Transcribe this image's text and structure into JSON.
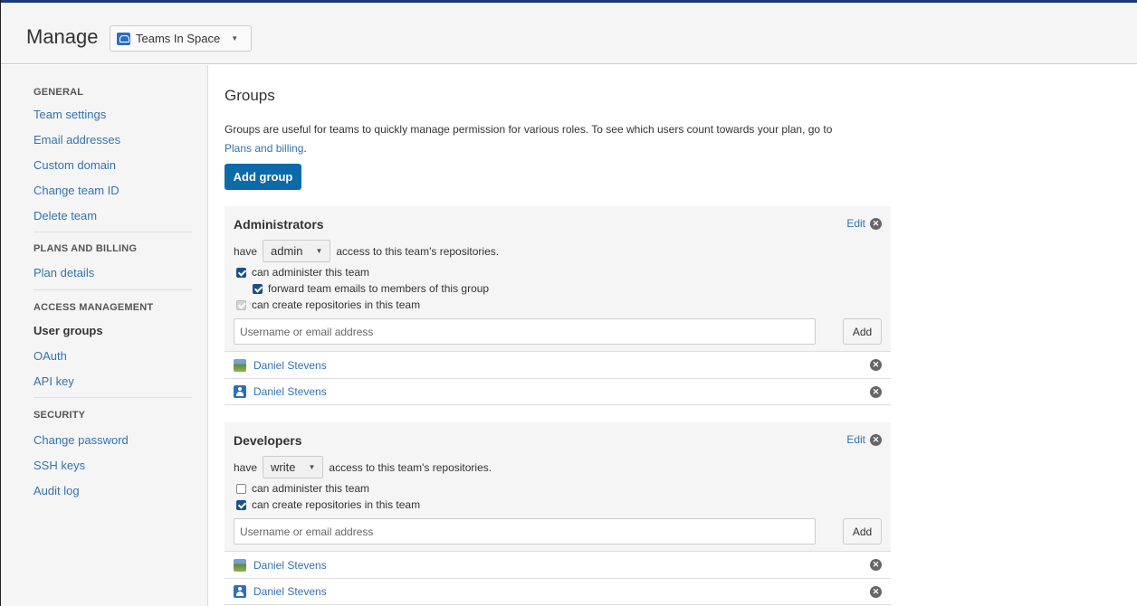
{
  "header": {
    "title": "Manage",
    "team_name": "Teams In Space"
  },
  "sidebar": {
    "general": {
      "heading": "GENERAL",
      "items": [
        "Team settings",
        "Email addresses",
        "Custom domain",
        "Change team ID",
        "Delete team"
      ]
    },
    "plans": {
      "heading": "PLANS AND BILLING",
      "items": [
        "Plan details"
      ]
    },
    "access": {
      "heading": "ACCESS MANAGEMENT",
      "items": [
        "User groups",
        "OAuth",
        "API key"
      ],
      "active": "User groups"
    },
    "security": {
      "heading": "SECURITY",
      "items": [
        "Change password",
        "SSH keys",
        "Audit log"
      ]
    }
  },
  "main": {
    "title": "Groups",
    "description": "Groups are useful for teams to quickly manage permission for various roles. To see which users count towards your plan, go to",
    "description_link": "Plans and billing",
    "description_end": ".",
    "add_group_label": "Add group"
  },
  "groups": [
    {
      "name": "Administrators",
      "edit_label": "Edit",
      "have_label": "have",
      "permission": "admin",
      "access_text": "access to this team's repositories.",
      "options": {
        "administer": "can administer this team",
        "forward": "forward team emails to members of this group",
        "create": "can create repositories in this team"
      },
      "input_placeholder": "Username or email address",
      "add_label": "Add",
      "members": [
        "Daniel Stevens",
        "Daniel Stevens"
      ]
    },
    {
      "name": "Developers",
      "edit_label": "Edit",
      "have_label": "have",
      "permission": "write",
      "access_text": "access to this team's repositories.",
      "options": {
        "administer": "can administer this team",
        "create": "can create repositories in this team"
      },
      "input_placeholder": "Username or email address",
      "add_label": "Add",
      "members": [
        "Daniel Stevens",
        "Daniel Stevens"
      ]
    }
  ],
  "colors": {
    "link": "#3572b0",
    "primary_button": "#0d6aa8",
    "panel_bg": "#f5f5f5"
  }
}
